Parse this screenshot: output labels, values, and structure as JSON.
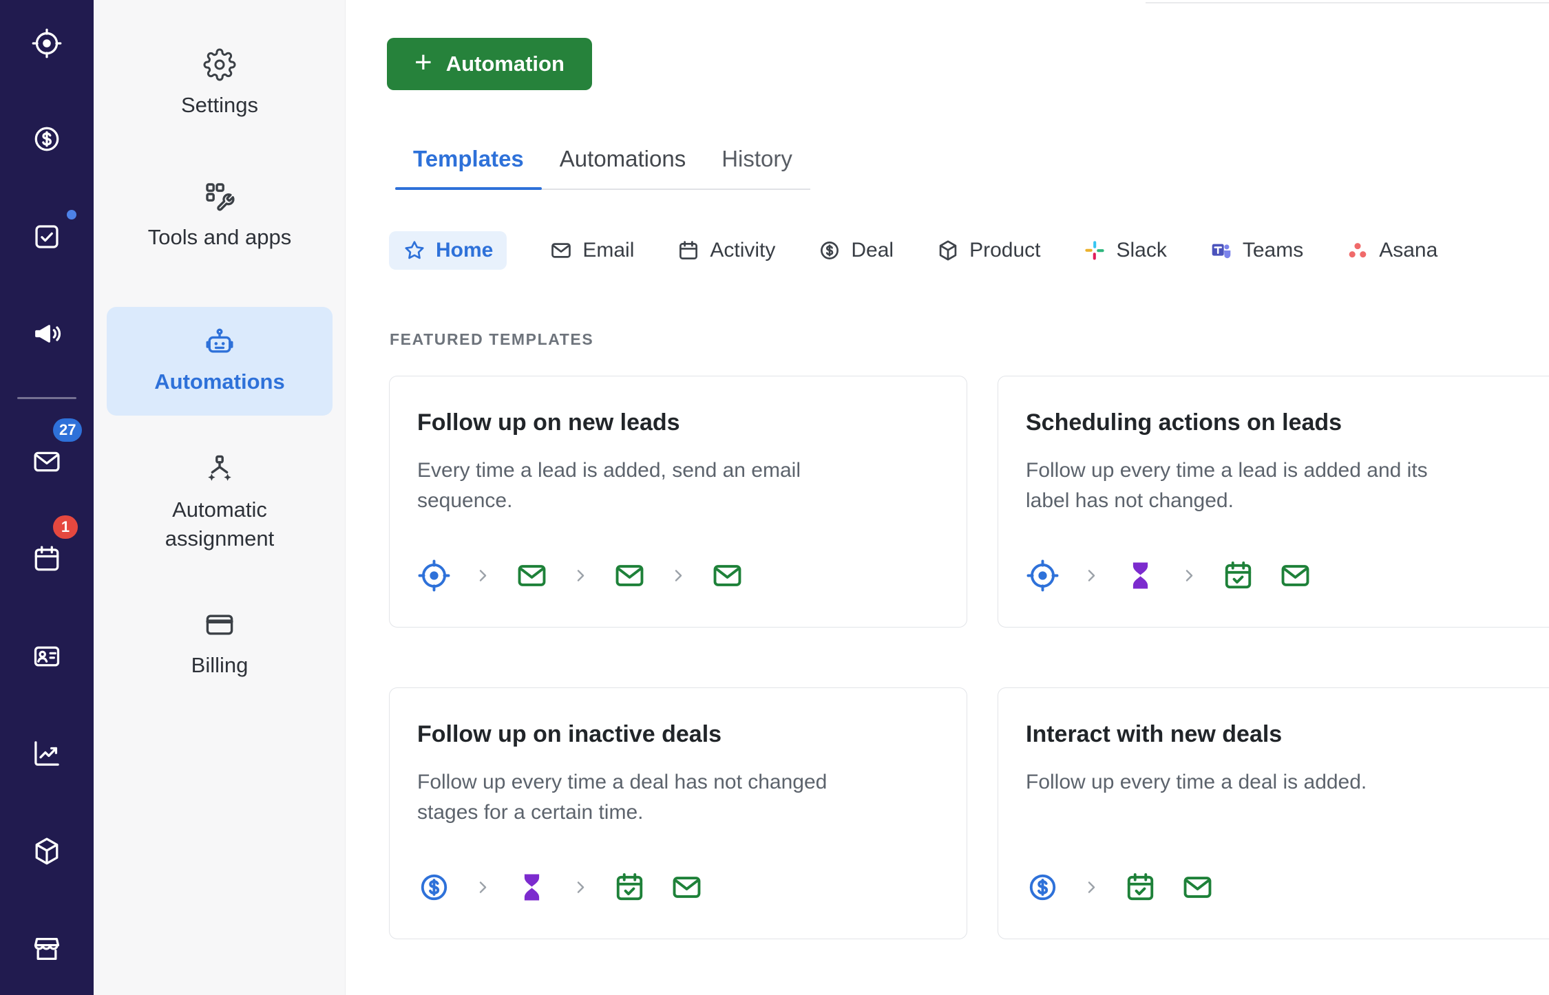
{
  "theme": {
    "blue": "#2e71d9",
    "blue-light": "#e8f1fc",
    "green": "#26823b",
    "icon-green": "#1e8139",
    "purple": "#7c2bce",
    "red": "#e5483f",
    "sidebar-bg": "#211b4f",
    "panel-bg": "#f7f7f8",
    "border": "#e2e4e8"
  },
  "app_sidebar": {
    "items": [
      {
        "name": "leads",
        "icon": "prospector-icon"
      },
      {
        "name": "deals",
        "icon": "deals-icon"
      },
      {
        "name": "activities",
        "icon": "activities-icon",
        "dot": true
      },
      {
        "name": "campaigns",
        "icon": "campaigns-icon",
        "divider_after": true
      },
      {
        "name": "mail",
        "icon": "mail-icon",
        "badge": "27",
        "badge_style": "blue"
      },
      {
        "name": "calendar",
        "icon": "calendar-icon",
        "badge": "1",
        "badge_style": "red"
      },
      {
        "name": "contacts",
        "icon": "contacts-icon"
      },
      {
        "name": "insights",
        "icon": "insights-icon"
      },
      {
        "name": "products",
        "icon": "products-icon"
      },
      {
        "name": "marketplace",
        "icon": "marketplace-icon"
      }
    ]
  },
  "settings_nav": {
    "items": [
      {
        "label": "Settings",
        "icon": "gear-icon",
        "active": false
      },
      {
        "label": "Tools and apps",
        "icon": "tools-icon",
        "active": false
      },
      {
        "label": "Automations",
        "icon": "robot-icon",
        "active": true
      },
      {
        "label": "Automatic assignment",
        "icon": "assignment-icon",
        "active": false
      },
      {
        "label": "Billing",
        "icon": "billing-icon",
        "active": false
      }
    ]
  },
  "main": {
    "new_automation_button": {
      "plus": "+",
      "label": "Automation"
    },
    "tabs": [
      {
        "label": "Templates",
        "active": true
      },
      {
        "label": "Automations",
        "active": false
      },
      {
        "label": "History",
        "active": false
      }
    ],
    "filters": [
      {
        "label": "Home",
        "icon": "star-icon",
        "active": true
      },
      {
        "label": "Email",
        "icon": "email-icon",
        "active": false
      },
      {
        "label": "Activity",
        "icon": "activity-icon",
        "active": false
      },
      {
        "label": "Deal",
        "icon": "deal-icon",
        "active": false
      },
      {
        "label": "Product",
        "icon": "product-icon",
        "active": false
      },
      {
        "label": "Slack",
        "icon": "slack-icon",
        "active": false
      },
      {
        "label": "Teams",
        "icon": "teams-icon",
        "active": false
      },
      {
        "label": "Asana",
        "icon": "asana-icon",
        "active": false
      }
    ],
    "section_title": "FEATURED TEMPLATES",
    "templates": [
      {
        "title": "Follow up on new leads",
        "description": "Every time a lead is added, send an email sequence.",
        "flow": [
          "lead-trigger-icon",
          "chevron-right-icon",
          "email-step-icon",
          "chevron-right-icon",
          "email-step-icon",
          "chevron-right-icon",
          "email-step-icon"
        ]
      },
      {
        "title": "Scheduling actions on leads",
        "description": "Follow up every time a lead is added and its label has not changed.",
        "flow": [
          "lead-trigger-icon",
          "chevron-right-icon",
          "wait-step-icon",
          "chevron-right-icon",
          "activity-step-icon",
          "email-step-icon"
        ]
      },
      {
        "title": "Follow up on inactive deals",
        "description": "Follow up every time a deal has not changed stages for a certain time.",
        "flow": [
          "deal-trigger-icon",
          "chevron-right-icon",
          "wait-step-icon",
          "chevron-right-icon",
          "activity-step-icon",
          "email-step-icon"
        ]
      },
      {
        "title": "Interact with new deals",
        "description": "Follow up every time a deal is added.",
        "flow": [
          "deal-trigger-icon",
          "chevron-right-icon",
          "activity-step-icon",
          "email-step-icon"
        ]
      }
    ]
  }
}
